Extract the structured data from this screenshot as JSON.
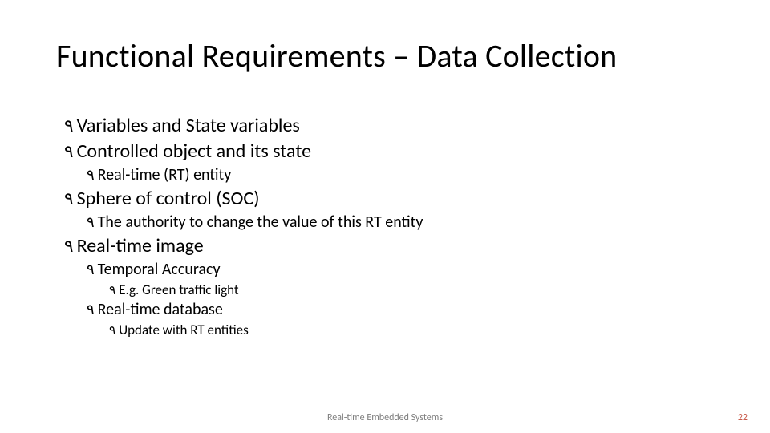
{
  "slide": {
    "title": "Functional Requirements – Data Collection",
    "items": {
      "a": "Variables and State variables",
      "b": "Controlled object and its state",
      "b1": "Real-time (RT) entity",
      "c": "Sphere of control (SOC)",
      "c1": "The authority to change the value of this RT entity",
      "d": "Real-time image",
      "d1": "Temporal Accuracy",
      "d1a": "E.g. Green traffic light",
      "d2": "Real-time database",
      "d2a": "Update with RT entities"
    },
    "footer": "Real-time Embedded Systems",
    "page": "22"
  },
  "glyph": "٩"
}
